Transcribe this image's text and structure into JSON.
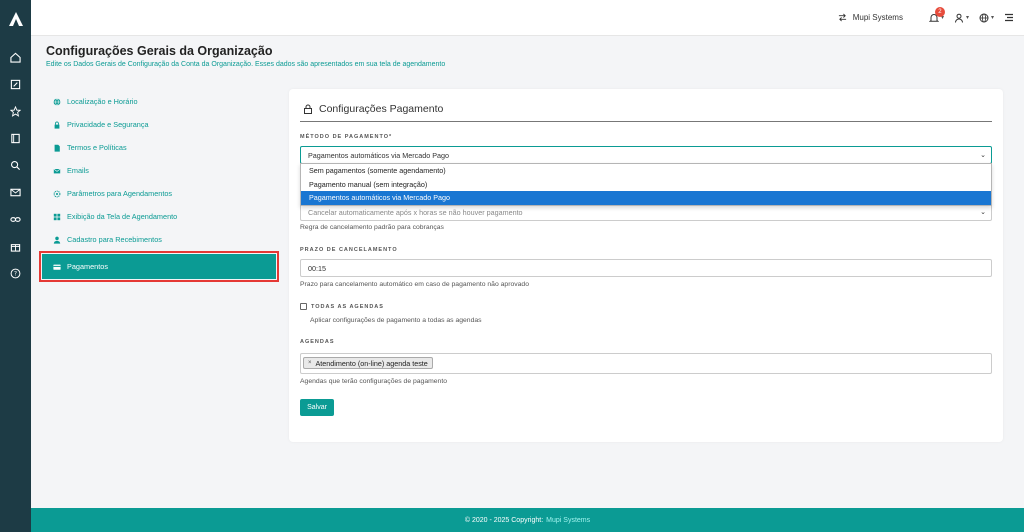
{
  "topbar": {
    "org_name": "Mupi Systems",
    "notification_count": "2"
  },
  "page": {
    "title": "Configurações Gerais da Organização",
    "subtitle": "Edite os Dados Gerais de Configuração da Conta da Organização. Esses dados são apresentados em sua tela de agendamento"
  },
  "menu": {
    "items": [
      {
        "label": "Localização e Horário",
        "icon": "globe-icon"
      },
      {
        "label": "Privacidade e Segurança",
        "icon": "lock-icon"
      },
      {
        "label": "Termos e Políticas",
        "icon": "file-icon"
      },
      {
        "label": "Emails",
        "icon": "mail-icon"
      },
      {
        "label": "Parâmetros para Agendamentos",
        "icon": "gear-icon"
      },
      {
        "label": "Exibição da Tela de Agendamento",
        "icon": "grid-icon"
      },
      {
        "label": "Cadastro para Recebimentos",
        "icon": "user-icon"
      },
      {
        "label": "Pagamentos",
        "icon": "card-icon"
      }
    ],
    "active_index": 7
  },
  "card": {
    "title": "Configurações Pagamento",
    "payment_method": {
      "label": "MÉTODO DE PAGAMENTO*",
      "value": "Pagamentos automáticos via Mercado Pago",
      "options": [
        "Sem pagamentos (somente agendamento)",
        "Pagamento manual (sem integração)",
        "Pagamentos automáticos via Mercado Pago"
      ],
      "selected_index": 2
    },
    "cancel_rule": {
      "value": "Cancelar automaticamente após x horas se não houver pagamento",
      "help": "Regra de cancelamento padrão para cobranças"
    },
    "cancel_deadline": {
      "label": "PRAZO DE CANCELAMENTO",
      "value": "00:15",
      "help": "Prazo para cancelamento automático em caso de pagamento não aprovado"
    },
    "all_schedules": {
      "label": "TODAS AS AGENDAS",
      "checked": false,
      "help": "Aplicar configurações de pagamento a todas as agendas"
    },
    "schedules": {
      "label": "AGENDAS",
      "tags": [
        "Atendimento (on-line) agenda teste"
      ],
      "help": "Agendas que terão configurações de pagamento"
    },
    "save_label": "Salvar"
  },
  "footer": {
    "copyright": "© 2020 - 2025 Copyright:",
    "brand": "Mupi Systems"
  },
  "colors": {
    "accent": "#0b9b94",
    "rail": "#1d3b45",
    "highlight_outline": "#e53935",
    "selected_option": "#1976d2",
    "badge": "#e74c3c"
  }
}
